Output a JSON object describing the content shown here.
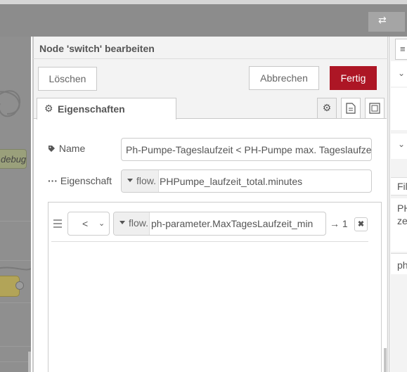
{
  "editor": {
    "title": "Node 'switch' bearbeiten",
    "buttons": {
      "delete": "Löschen",
      "cancel": "Abbrechen",
      "done": "Fertig"
    },
    "tab_properties": "Eigenschaften"
  },
  "form": {
    "name_label": "Name",
    "name_value": "Ph-Pumpe-Tageslaufzeit < PH-Pumpe max. Tageslaufze",
    "property_label": "Eigenschaft",
    "property_type": "flow.",
    "property_value": "PHPumpe_laufzeit_total.minutes"
  },
  "rule": {
    "operator": "<",
    "value_type": "flow.",
    "value": "ph-parameter.MaxTagesLaufzeit_min",
    "output": "→ 1",
    "remove": "✖"
  },
  "workspace": {
    "debug_label": "debug"
  },
  "sidebar": {
    "text_fil": "Fil",
    "text_ph": "PH",
    "text_ze": "ze",
    "text_ph2": "ph"
  },
  "icons": {
    "tag": "tag-icon",
    "ellipsis": "ellipsis-icon",
    "gear": "gear-icon",
    "description": "document-icon",
    "appearance": "frame-icon",
    "drag": "drag-handle-icon",
    "caret": "caret-down-icon",
    "deploy": "deploy-icon"
  },
  "colors": {
    "primary": "#ad1625",
    "header": "#8c8c8c"
  }
}
